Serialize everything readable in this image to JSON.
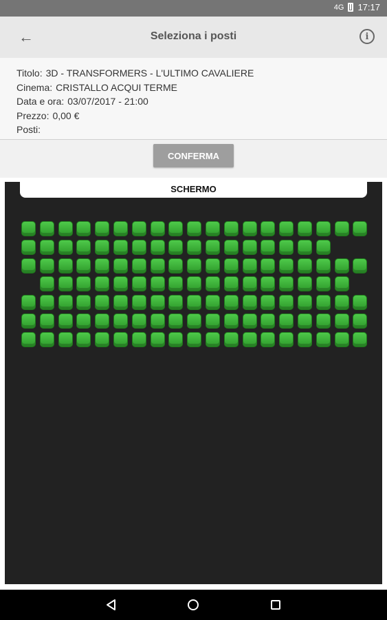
{
  "status_bar": {
    "network": "4G",
    "time": "17:17"
  },
  "app_bar": {
    "title": "Seleziona i posti"
  },
  "details": [
    {
      "label": "Titolo:",
      "value": "3D - TRANSFORMERS - L'ULTIMO CAVALIERE"
    },
    {
      "label": "Cinema:",
      "value": "CRISTALLO ACQUI TERME"
    },
    {
      "label": "Data e ora:",
      "value": "03/07/2017 - 21:00"
    },
    {
      "label": "Prezzo:",
      "value": "0,00 €"
    },
    {
      "label": "Posti:",
      "value": ""
    }
  ],
  "confirm_label": "CONFERMA",
  "screen_label": "SCHERMO",
  "seat_colors": {
    "available": "#3cb33a"
  },
  "seat_rows": [
    [
      0,
      1,
      2,
      3,
      4,
      5,
      6,
      7,
      8,
      9,
      10,
      11,
      12,
      13,
      14,
      15,
      16,
      17,
      18
    ],
    [
      0,
      1,
      2,
      3,
      4,
      5,
      6,
      7,
      8,
      9,
      10,
      11,
      12,
      13,
      14,
      15,
      16
    ],
    [
      0,
      1,
      2,
      3,
      4,
      5,
      6,
      7,
      8,
      9,
      10,
      11,
      12,
      13,
      14,
      15,
      16,
      17,
      18
    ],
    [
      1,
      2,
      3,
      4,
      5,
      6,
      7,
      8,
      9,
      10,
      11,
      12,
      13,
      14,
      15,
      16,
      17
    ],
    [
      0,
      1,
      2,
      3,
      4,
      5,
      6,
      7,
      8,
      9,
      10,
      11,
      12,
      13,
      14,
      15,
      16,
      17,
      18
    ],
    [
      0,
      1,
      2,
      3,
      4,
      5,
      6,
      7,
      8,
      9,
      10,
      11,
      12,
      13,
      14,
      15,
      16,
      17,
      18
    ],
    [
      0,
      1,
      2,
      3,
      4,
      5,
      6,
      7,
      8,
      9,
      10,
      11,
      12,
      13,
      14,
      15,
      16,
      17,
      18
    ]
  ]
}
